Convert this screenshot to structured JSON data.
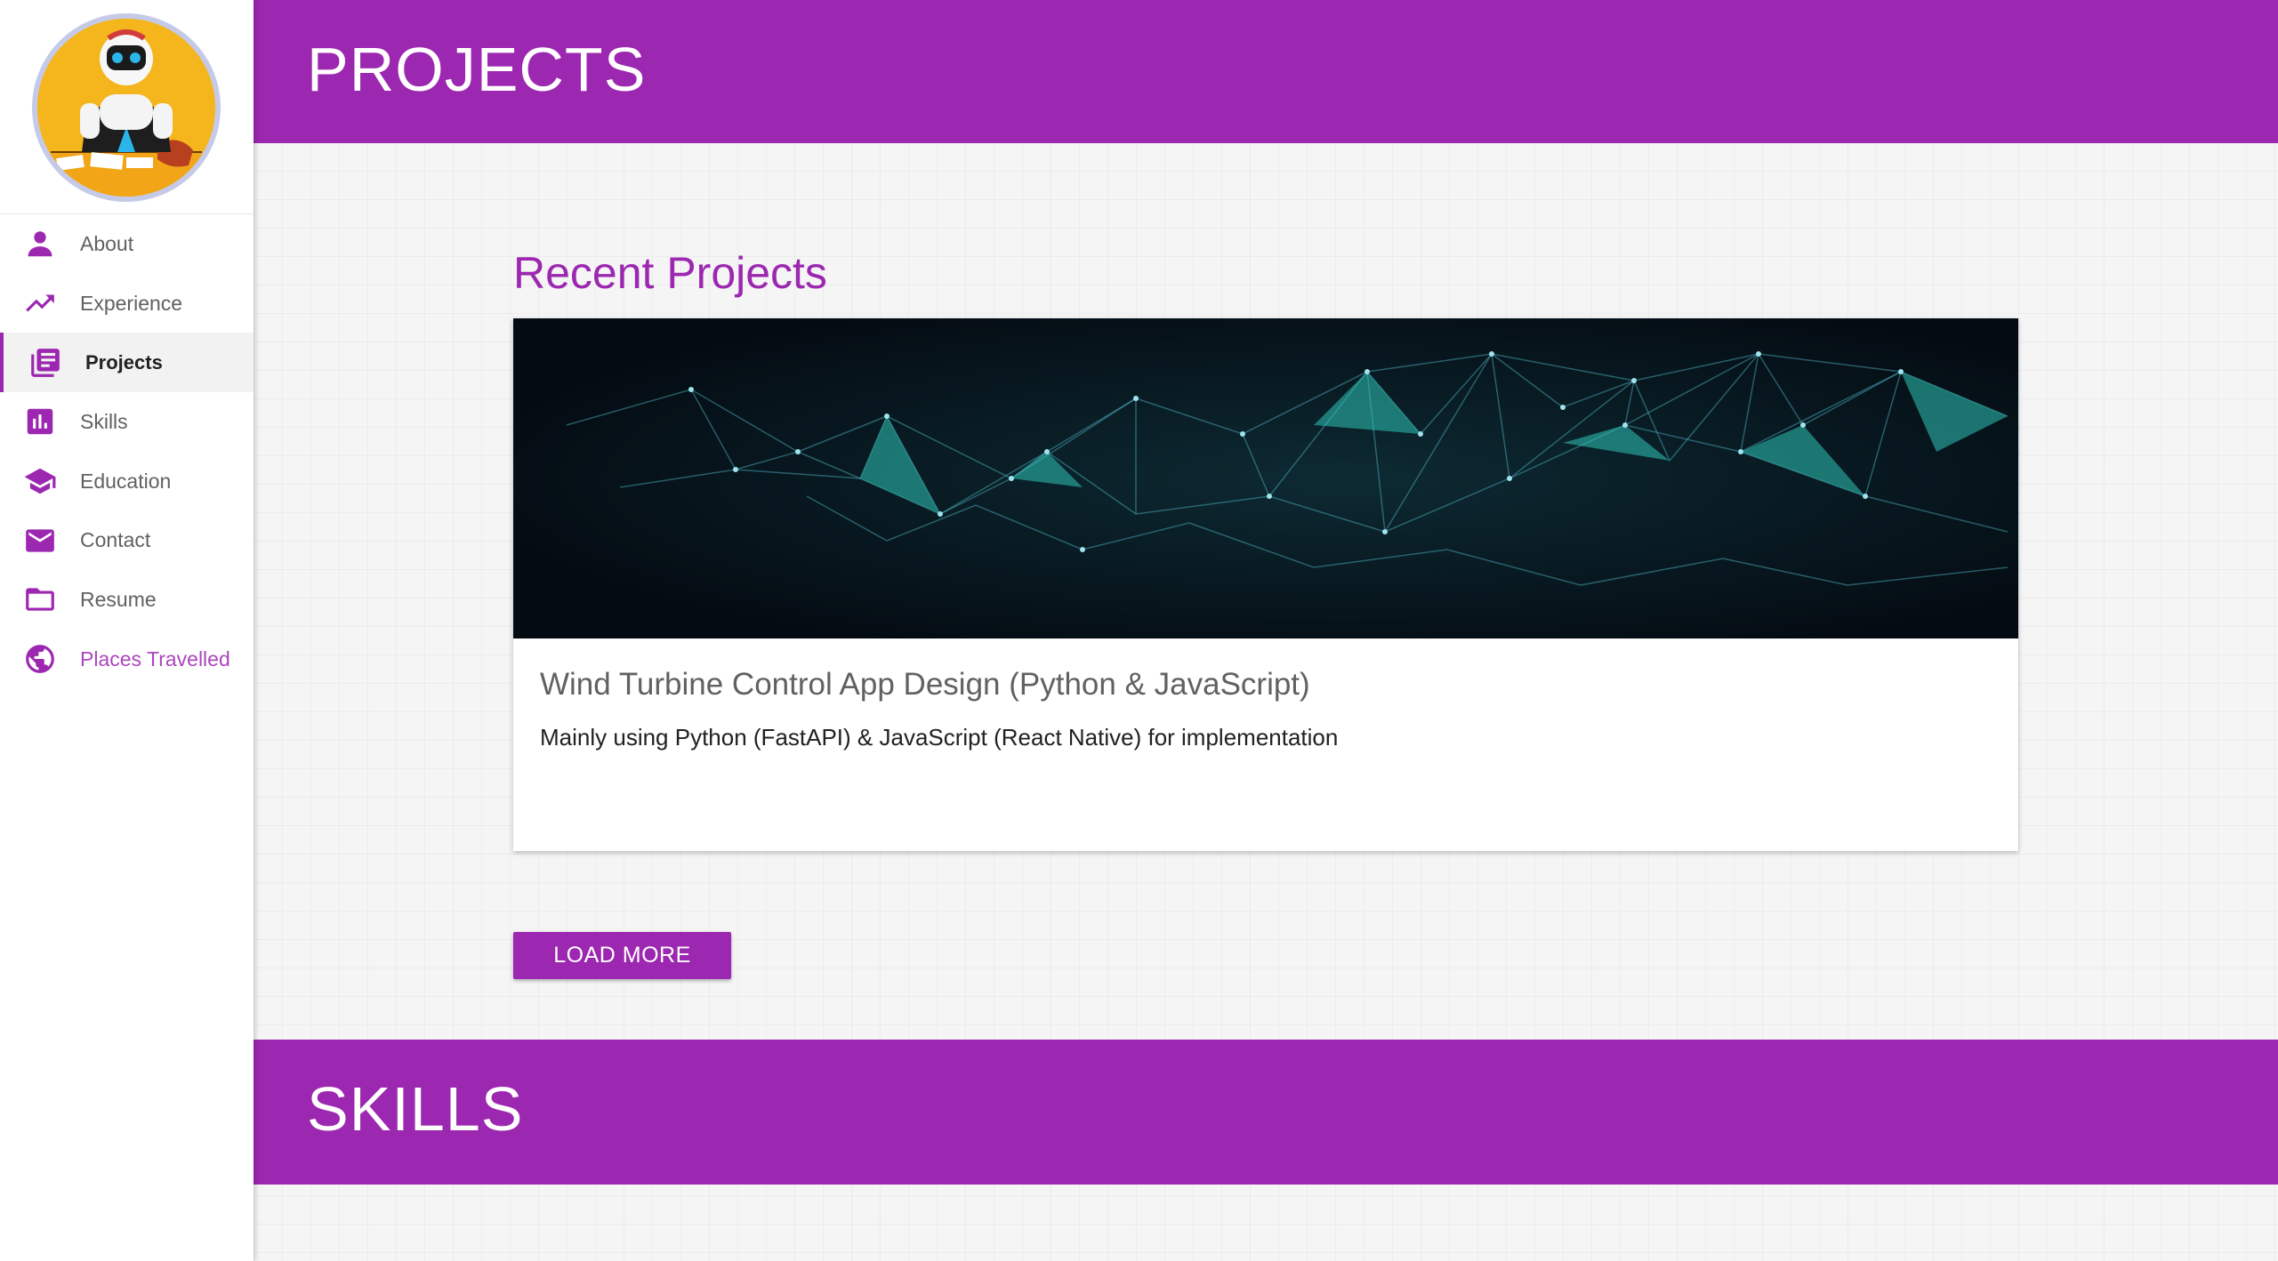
{
  "sidebar": {
    "avatar_alt": "profile avatar",
    "items": [
      {
        "label": "About",
        "icon": "person-icon"
      },
      {
        "label": "Experience",
        "icon": "trending-up-icon"
      },
      {
        "label": "Projects",
        "icon": "library-books-icon",
        "active": true
      },
      {
        "label": "Skills",
        "icon": "bar-chart-icon"
      },
      {
        "label": "Education",
        "icon": "graduation-cap-icon"
      },
      {
        "label": "Contact",
        "icon": "mail-icon"
      },
      {
        "label": "Resume",
        "icon": "folder-icon"
      },
      {
        "label": "Places Travelled",
        "icon": "globe-icon"
      }
    ]
  },
  "projects_section": {
    "header": "PROJECTS",
    "recent_title": "Recent Projects",
    "card": {
      "title": "Wind Turbine Control App Design (Python & JavaScript)",
      "description": "Mainly using Python (FastAPI) & JavaScript (React Native) for implementation"
    },
    "load_more_label": "LOAD MORE"
  },
  "skills_section": {
    "header": "SKILLS"
  },
  "colors": {
    "accent": "#9c27b0",
    "header_bg": "#9c27b0",
    "link": "#ab47bc",
    "page_bg": "#f5f5f5"
  }
}
